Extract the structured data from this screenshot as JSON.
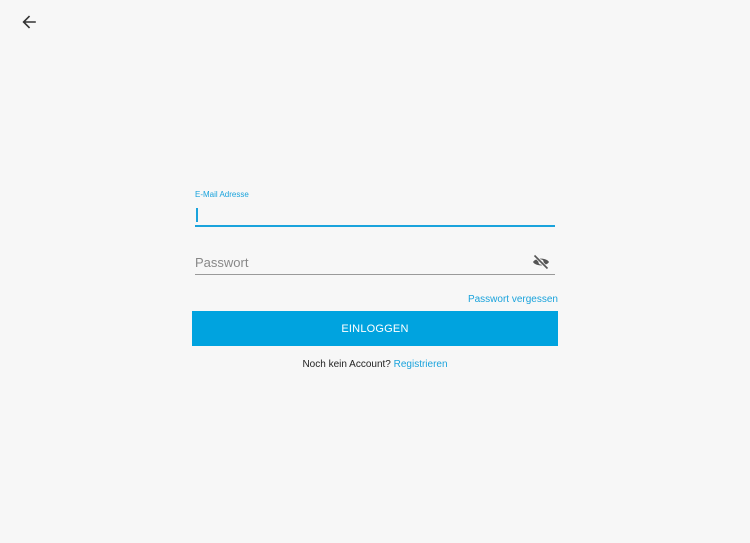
{
  "icons": {
    "back": "arrow-left-icon",
    "password_toggle": "eye-off-icon"
  },
  "colors": {
    "accent": "#1aa3dc",
    "button": "#00a3df",
    "background": "#f7f7f7"
  },
  "login_form": {
    "email_label": "E-Mail Adresse",
    "email_value": "",
    "password_placeholder": "Passwort",
    "password_value": "",
    "forgot_password_link": "Passwort vergessen",
    "login_button_label": "EINLOGGEN",
    "no_account_text": "Noch kein Account? ",
    "register_link": "Registrieren"
  }
}
